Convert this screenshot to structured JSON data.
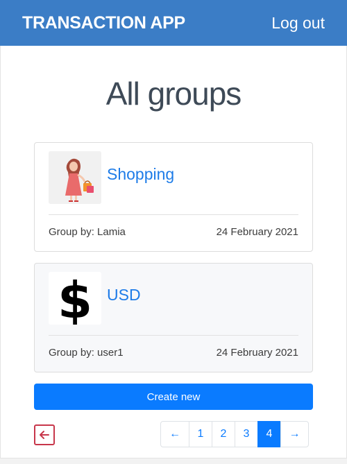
{
  "navbar": {
    "brand": "TRANSACTION APP",
    "logout_label": "Log out"
  },
  "page_title": "All groups",
  "groups": [
    {
      "name": "Shopping",
      "group_by": "Group by: Lamia",
      "date": "24 February 2021",
      "icon": "shopping-woman-icon"
    },
    {
      "name": "USD",
      "group_by": "Group by: user1",
      "date": "24 February 2021",
      "icon": "dollar-sign-icon"
    }
  ],
  "create_label": "Create new",
  "back_icon": "arrow-left-box-icon",
  "pagination": {
    "prev": "←",
    "pages": [
      "1",
      "2",
      "3",
      "4"
    ],
    "current": "4",
    "next": "→"
  },
  "colors": {
    "navbar": "#3b7dc6",
    "primary": "#0a7bff",
    "link": "#1e7ce8",
    "back_button": "#c7364a"
  }
}
